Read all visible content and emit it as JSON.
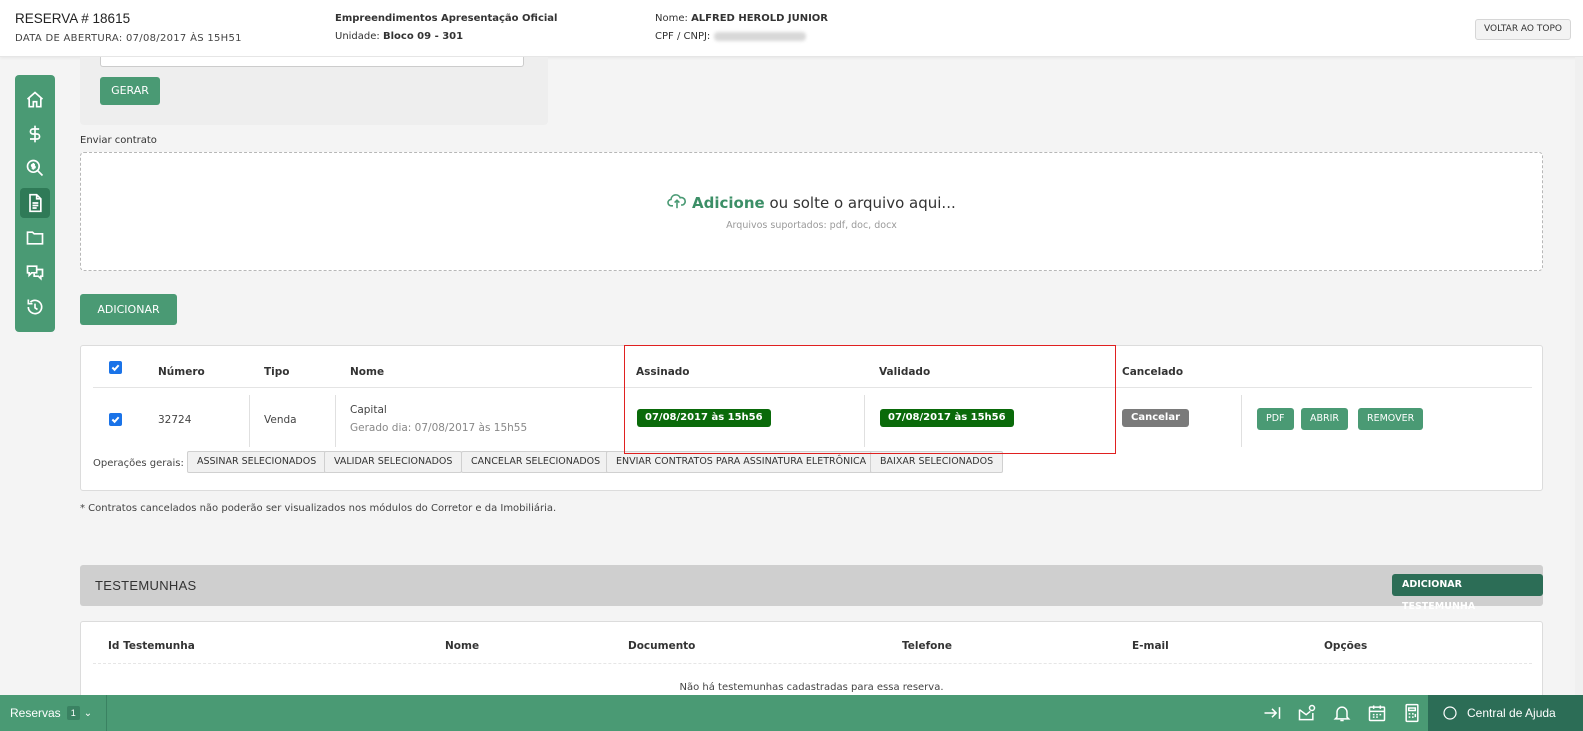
{
  "header": {
    "reserva_title": "RESERVA # 18615",
    "data_abertura": "DATA DE ABERTURA: 07/08/2017 ÀS 15H51",
    "empreendimento": "Empreendimentos Apresentação Oficial",
    "unidade_label": "Unidade:",
    "unidade_value": "Bloco 09 - 301",
    "nome_label": "Nome:",
    "nome_value": "ALFRED HEROLD JUNIOR",
    "cpf_label": "CPF / CNPJ:",
    "voltar_label": "VOLTAR AO TOPO"
  },
  "sidenav": {
    "items": [
      "home-icon",
      "dollar-icon",
      "search-dollar-icon",
      "document-icon",
      "folder-icon",
      "comments-icon",
      "history-icon"
    ],
    "active": "document-icon"
  },
  "generator": {
    "gerar_label": "GERAR"
  },
  "upload": {
    "label": "Enviar contrato",
    "add_text": "Adicione",
    "rest_text": " ou solte o arquivo aqui...",
    "supported": "Arquivos suportados: pdf, doc, docx",
    "adicionar_label": "ADICIONAR"
  },
  "contracts": {
    "columns": [
      "Número",
      "Tipo",
      "Nome",
      "Assinado",
      "Validado",
      "Cancelado"
    ],
    "rows": [
      {
        "numero": "32724",
        "tipo": "Venda",
        "nome": "Capital",
        "gerado": "Gerado dia: 07/08/2017 às 15h55",
        "assinado": "07/08/2017 às 15h56",
        "validado": "07/08/2017 às 15h56",
        "cancelar_label": "Cancelar",
        "actions": [
          "PDF",
          "ABRIR",
          "REMOVER"
        ]
      }
    ],
    "ops_label": "Operações gerais:",
    "ops": [
      "ASSINAR SELECIONADOS",
      "VALIDAR SELECIONADOS",
      "CANCELAR SELECIONADOS",
      "ENVIAR CONTRATOS PARA ASSINATURA ELETRÔNICA",
      "BAIXAR SELECIONADOS"
    ]
  },
  "note": "* Contratos cancelados não poderão ser visualizados nos módulos do Corretor e da Imobiliária.",
  "testemunhas": {
    "title": "TESTEMUNHAS",
    "add_label": "ADICIONAR TESTEMUNHA",
    "columns": [
      "Id Testemunha",
      "Nome",
      "Documento",
      "Telefone",
      "E-mail",
      "Opções"
    ],
    "empty": "Não há testemunhas cadastradas para essa reserva."
  },
  "bottombar": {
    "reservas_label": "Reservas",
    "reservas_count": "1",
    "icons": [
      "collapse-right-icon",
      "mail-icon",
      "bell-icon",
      "calendar-icon",
      "calculator-icon"
    ],
    "help_label": "Central de Ajuda"
  },
  "colors": {
    "primary": "#4a9a74",
    "dark": "#2c6d56",
    "date_badge": "#0a6a0a",
    "highlight": "#e02020"
  }
}
